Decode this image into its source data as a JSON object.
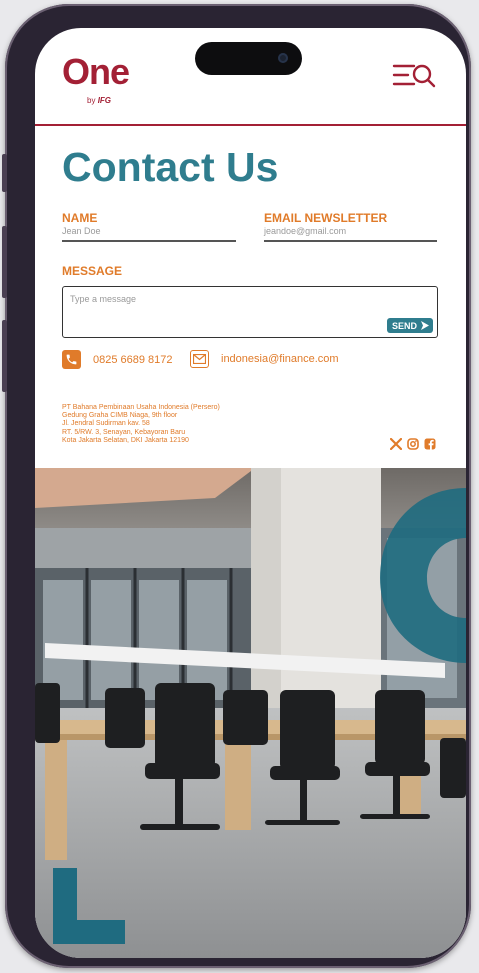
{
  "brand": {
    "logo_text": "One",
    "by_text": "by",
    "group_text": "IFG",
    "primary_color": "#a32035",
    "accent_color": "#e07b2a",
    "teal_color": "#2f7d8e"
  },
  "header": {
    "menu_icon": "menu-icon",
    "search_icon": "search-icon"
  },
  "page": {
    "title": "Contact Us"
  },
  "form": {
    "name_label": "NAME",
    "name_value": "Jean Doe",
    "email_label": "EMAIL NEWSLETTER",
    "email_value": "jeandoe@gmail.com",
    "message_label": "MESSAGE",
    "message_placeholder": "Type a message",
    "send_label": "SEND"
  },
  "contact": {
    "phone": "0825 6689 8172",
    "email": "indonesia@finance.com"
  },
  "address": {
    "lines": [
      "PT Bahana Pembinaan Usaha Indonesia (Persero)",
      "Gedung Graha CIMB Niaga, 9th floor",
      "Jl. Jendral Sudirman kav. 58",
      "RT. 5/RW. 3, Senayan, Kebayoran Baru",
      "Kota Jakarta Selatan, DKI Jakarta 12190"
    ]
  },
  "socials": [
    "x-icon",
    "instagram-icon",
    "facebook-icon"
  ]
}
